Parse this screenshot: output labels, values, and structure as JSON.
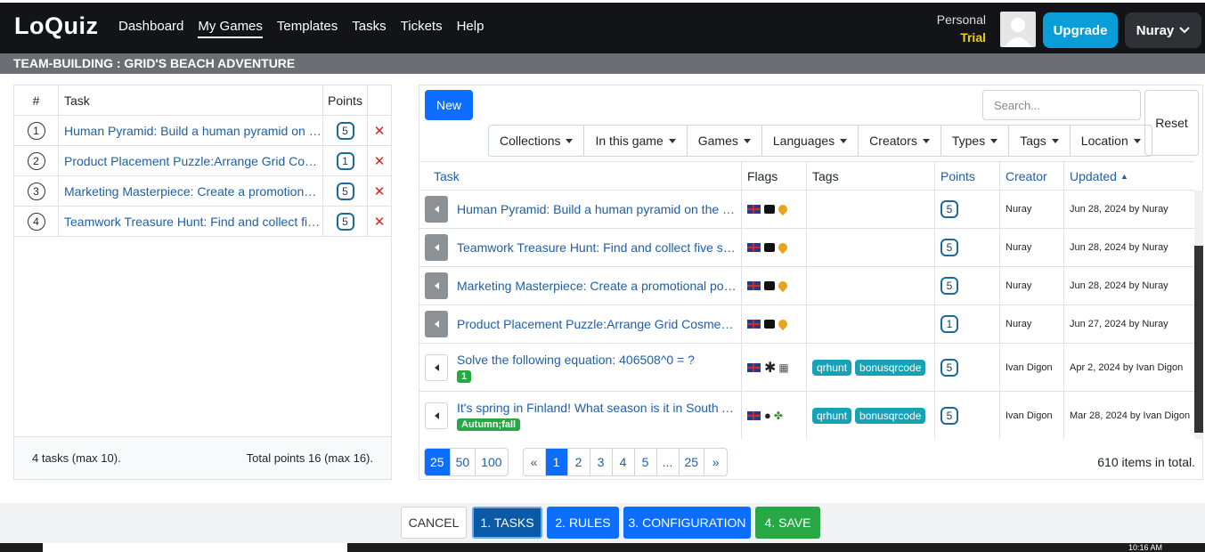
{
  "nav": {
    "logo": "LoQuiz",
    "links": [
      "Dashboard",
      "My Games",
      "Templates",
      "Tasks",
      "Tickets",
      "Help"
    ],
    "active": "My Games",
    "plan_line1": "Personal",
    "plan_line2": "Trial",
    "upgrade": "Upgrade",
    "user": "Nuray"
  },
  "game_title": "TEAM-BUILDING : GRID'S BEACH ADVENTURE",
  "selected": {
    "headers": {
      "num": "#",
      "task": "Task",
      "points": "Points"
    },
    "rows": [
      {
        "num": "1",
        "task": "Human Pyramid: Build a human pyramid on the beach",
        "points": "5"
      },
      {
        "num": "2",
        "task": "Product Placement Puzzle:Arrange Grid Cosmetic products",
        "points": "1"
      },
      {
        "num": "3",
        "task": "Marketing Masterpiece: Create a promotional poster",
        "points": "5"
      },
      {
        "num": "4",
        "task": "Teamwork Treasure Hunt: Find and collect five special items",
        "points": "5"
      }
    ],
    "footer_left": "4 tasks (max 10).",
    "footer_right": "Total points 16 (max 16)."
  },
  "library": {
    "new_button": "New",
    "search_placeholder": "Search...",
    "reset": "Reset",
    "filters": [
      "Collections",
      "In this game",
      "Games",
      "Languages",
      "Creators",
      "Types",
      "Tags",
      "Location"
    ],
    "headers": {
      "task": "Task",
      "flags": "Flags",
      "tags": "Tags",
      "points": "Points",
      "creator": "Creator",
      "updated": "Updated"
    },
    "rows": [
      {
        "task": "Human Pyramid: Build a human pyramid on the beach",
        "points": "5",
        "creator": "Nuray",
        "updated": "Jun 28, 2024 by Nuray"
      },
      {
        "task": "Teamwork Treasure Hunt: Find and collect five special items",
        "points": "5",
        "creator": "Nuray",
        "updated": "Jun 28, 2024 by Nuray"
      },
      {
        "task": "Marketing Masterpiece: Create a promotional poster",
        "points": "5",
        "creator": "Nuray",
        "updated": "Jun 28, 2024 by Nuray"
      },
      {
        "task": "Product Placement Puzzle:Arrange Grid Cosmetic products",
        "points": "1",
        "creator": "Nuray",
        "updated": "Jun 27, 2024 by Nuray"
      },
      {
        "task": "Solve the following equation: 406508^0 = ?",
        "answer": "1",
        "tag1": "qrhunt",
        "tag2": "bonusqrcode",
        "points": "5",
        "creator": "Ivan Digon",
        "updated": "Apr 2, 2024 by Ivan Digon"
      },
      {
        "task": "It's spring in Finland! What season is it in South Africa?",
        "answer": "Autumn;fall",
        "tag1": "qrhunt",
        "tag2": "bonusqrcode",
        "points": "5",
        "creator": "Ivan Digon",
        "updated": "Mar 28, 2024 by Ivan Digon"
      }
    ],
    "page_sizes": [
      "25",
      "50",
      "100"
    ],
    "pages": [
      "«",
      "1",
      "2",
      "3",
      "4",
      "5",
      "...",
      "25",
      "»"
    ],
    "total": "610 items in total."
  },
  "steps": {
    "cancel": "CANCEL",
    "tasks": "1. TASKS",
    "rules": "2. RULES",
    "config": "3. CONFIGURATION",
    "save": "4. SAVE"
  },
  "clock": "10:16 AM"
}
